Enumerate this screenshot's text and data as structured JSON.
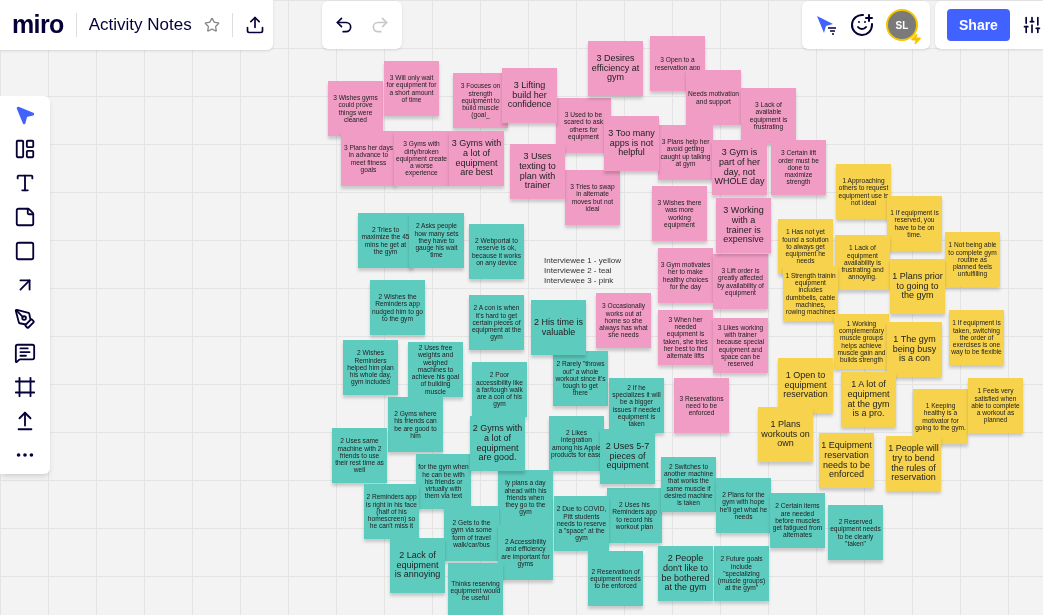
{
  "topbar": {
    "logo": "miro",
    "board_title": "Activity Notes",
    "starred": false,
    "history": [
      {
        "kind": "undo",
        "disabled": false
      },
      {
        "kind": "redo",
        "disabled": true
      }
    ],
    "avatar": "SL",
    "share": "Share"
  },
  "tools": [
    {
      "kind": "select",
      "selected": true
    },
    {
      "kind": "templates",
      "selected": false
    },
    {
      "kind": "text",
      "selected": false
    },
    {
      "kind": "sticky",
      "selected": false
    },
    {
      "kind": "shape",
      "selected": false
    },
    {
      "kind": "arrow",
      "selected": false
    },
    {
      "kind": "pen",
      "selected": false
    },
    {
      "kind": "comment",
      "selected": false
    },
    {
      "kind": "frame",
      "selected": false
    },
    {
      "kind": "upload",
      "selected": false
    },
    {
      "kind": "more",
      "selected": false
    }
  ],
  "legend": [
    "Interviewee 1 - yellow",
    "Interviewee 2 - teal",
    "Interviewee 3 - pink"
  ],
  "notes": [
    {
      "text": "3 Wishes gyms could prove things were cleaned",
      "color": "#f09cc4"
    },
    {
      "text": "3 Will only wait for equipment for a short amount of time",
      "color": "#f09cc4"
    },
    {
      "text": "3 Focuses on strength equipment to build muscle (goal_",
      "color": "#f09cc4"
    },
    {
      "text": "3 Lifting build her confidence",
      "color": "#f09cc4"
    },
    {
      "text": "3 Desires efficiency at gym",
      "color": "#f09cc4"
    },
    {
      "text": "3 Open to a reservation app",
      "color": "#f09cc4"
    },
    {
      "text": "Needs motivation and support",
      "color": "#f09cc4"
    },
    {
      "text": "3 Lack of available equipment is frustrating",
      "color": "#f09cc4"
    },
    {
      "text": "3 Used to be scared to ask others for equipment",
      "color": "#f09cc4"
    },
    {
      "text": "3 Plans her days in advance to meet fitness goals",
      "color": "#f09cc4"
    },
    {
      "text": "3 Gyms with dirty/broken equipment create a worse experience",
      "color": "#f09cc4"
    },
    {
      "text": "3 Gyms with a lot of equipment are best",
      "color": "#f09cc4"
    },
    {
      "text": "3 Uses texting to plan with trainer",
      "color": "#f09cc4"
    },
    {
      "text": "3 Too many apps is not helpful",
      "color": "#f09cc4"
    },
    {
      "text": "3 Plans help her avoid getting caught up talking at gym",
      "color": "#f09cc4"
    },
    {
      "text": "3 Gym is part of her day, not WHOLE day",
      "color": "#f09cc4"
    },
    {
      "text": "3 Certain lift order must be done to maximize strength",
      "color": "#f09cc4"
    },
    {
      "text": "3 Tries to swap in alternate moves but not ideal",
      "color": "#f09cc4"
    },
    {
      "text": "3 Wishes there was more working equipment",
      "color": "#f09cc4"
    },
    {
      "text": "3 Working with a trainer is expensive",
      "color": "#f09cc4"
    },
    {
      "text": "3 Gym motivates her to make healthy choices for the day",
      "color": "#f09cc4"
    },
    {
      "text": "3 Lift order is greatly affected by availability of equipment",
      "color": "#f09cc4"
    },
    {
      "text": "3 Occasionally works out at home so she always has what she needs",
      "color": "#f09cc4"
    },
    {
      "text": "3 When her needed equipment is taken, she tries her best to find alternate lifts",
      "color": "#f09cc4"
    },
    {
      "text": "3 Likes working with trainer because special equipment and space can be reserved",
      "color": "#f09cc4"
    },
    {
      "text": "3 Reservations need to be enforced",
      "color": "#f09cc4"
    },
    {
      "text": "2 Tries to maximize the 45 mins he get at the gym",
      "color": "#5ecbbf"
    },
    {
      "text": "2 Asks people how many sets they have to gauge his wait time",
      "color": "#5ecbbf"
    },
    {
      "text": "2 Webportal to reserve is ok, because it works on any device",
      "color": "#5ecbbf"
    },
    {
      "text": "2 Wishes the Reminders app nudged him to go to the gym",
      "color": "#5ecbbf"
    },
    {
      "text": "2 A con is when it's hard to get certain pieces of equipment at the gym",
      "color": "#5ecbbf"
    },
    {
      "text": "2 His time is valuable",
      "color": "#5ecbbf"
    },
    {
      "text": "2 Rarely \"throws out\" a whole workout since it's tough to get there",
      "color": "#5ecbbf"
    },
    {
      "text": "2 Wishes Reminders helped him plan his whole day, gym included",
      "color": "#5ecbbf"
    },
    {
      "text": "2 Uses free weights and weighed machines to achieve his goal of building muscle",
      "color": "#5ecbbf"
    },
    {
      "text": "2 Poor accessibility like a far/tough walk are a con of his gym",
      "color": "#5ecbbf"
    },
    {
      "text": "2 If he specializes it will be a bigger issues if needed equipment is taken",
      "color": "#5ecbbf"
    },
    {
      "text": "2 Gyms where his friends can be are good to him",
      "color": "#5ecbbf"
    },
    {
      "text": "2 Uses same machine with 2 friends to use their rest time as well",
      "color": "#5ecbbf"
    },
    {
      "text": "for the gym when he can be with his friends or virtually with them via text",
      "color": "#5ecbbf"
    },
    {
      "text": "2 Gyms with a lot of equipment are good.",
      "color": "#5ecbbf"
    },
    {
      "text": "2 Likes integration among his Apple products for ease",
      "color": "#5ecbbf"
    },
    {
      "text": "2 Uses 5-7 pieces of equipment",
      "color": "#5ecbbf"
    },
    {
      "text": "ly plans a day ahead with his friends when they go to the gym",
      "color": "#5ecbbf"
    },
    {
      "text": "2 Reminders app is right in his face (half of his homescreen) so he can't miss it",
      "color": "#5ecbbf"
    },
    {
      "text": "2 Gets to the gym via some form of travel walk/car/bus",
      "color": "#5ecbbf"
    },
    {
      "text": "2 Uses his Reminders app to record his workout plan",
      "color": "#5ecbbf"
    },
    {
      "text": "2 Switches to another machine that works the same muscle if desired machine is taken",
      "color": "#5ecbbf"
    },
    {
      "text": "2 Plans for the gym with hope he'll get what he needs",
      "color": "#5ecbbf"
    },
    {
      "text": "2 Due to COVID, Pitt students needs to reserve a \"space\" at the gym",
      "color": "#5ecbbf"
    },
    {
      "text": "2 Lack of equipment is annoying",
      "color": "#5ecbbf"
    },
    {
      "text": "2 Accessibility and efficiency are important for gyms",
      "color": "#5ecbbf"
    },
    {
      "text": "2 Reservation of equipment needs to be enforced",
      "color": "#5ecbbf"
    },
    {
      "text": "2 People don't like to be bothered at the gym",
      "color": "#5ecbbf"
    },
    {
      "text": "2 Future goals include \"specializing (muscle groups) at the gym\"",
      "color": "#5ecbbf"
    },
    {
      "text": "2 Certain items are needed before muscles get fatigued from alternates",
      "color": "#5ecbbf"
    },
    {
      "text": "2 Reserved equipment needs to be clearly \"taken\"",
      "color": "#5ecbbf"
    },
    {
      "text": "Thinks reserving equipment would be useful",
      "color": "#5ecbbf"
    },
    {
      "text": "1 Approaching others to request equipment use is not ideal",
      "color": "#f6d24d"
    },
    {
      "text": "1 If equipment is reserved, you have to be on time.",
      "color": "#f6d24d"
    },
    {
      "text": "1 Has not yet found a solution to always get equipment he needs",
      "color": "#f6d24d"
    },
    {
      "text": "1 Lack of equipment availability is frustrating and annoying.",
      "color": "#f6d24d"
    },
    {
      "text": "1 Not being able to complete gym routine as planned feels unfulfilling",
      "color": "#f6d24d"
    },
    {
      "text": "1 Strength trainin equipment includes dumbbells, cable machines, rowing machines",
      "color": "#f6d24d"
    },
    {
      "text": "1 Plans prior to going to the gym",
      "color": "#f6d24d"
    },
    {
      "text": "1 Working complementary muscle groups helps achieve muscle gain and builds strength",
      "color": "#f6d24d"
    },
    {
      "text": "1 The gym being busy is a con",
      "color": "#f6d24d"
    },
    {
      "text": "1 If equipment is taken, switching the order of exercises is one way to be flexible",
      "color": "#f6d24d"
    },
    {
      "text": "1 Open to equipment reservation",
      "color": "#f6d24d"
    },
    {
      "text": "1 A lot of equipment at the gym is a pro.",
      "color": "#f6d24d"
    },
    {
      "text": "1 Keeping healthy is a motivator for going to the gym.",
      "color": "#f6d24d"
    },
    {
      "text": "1 Feels very satisfied when able to complete a workout as planned",
      "color": "#f6d24d"
    },
    {
      "text": "1 Plans workouts on own",
      "color": "#f6d24d"
    },
    {
      "text": "1 Equipment reservation needs to be enforced",
      "color": "#f6d24d"
    },
    {
      "text": "1 People will try to bend the rules of reservation",
      "color": "#f6d24d"
    }
  ]
}
